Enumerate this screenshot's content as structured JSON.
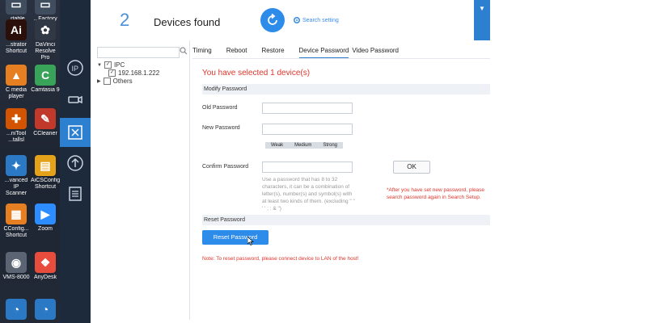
{
  "desktop": {
    "icons": [
      {
        "label": "..rtable",
        "color": "#3f4d5e",
        "glyph": "▭"
      },
      {
        "label": "...Factory\n...",
        "color": "#3f4d5e",
        "glyph": "▭"
      },
      {
        "label": "...strator\nShortcut",
        "color": "#2a0f0a",
        "glyph": "Ai"
      },
      {
        "label": "DaVinci\nResolve Pro",
        "color": "#303845",
        "glyph": "✿"
      },
      {
        "label": "C media\nplayer",
        "color": "#e67e22",
        "glyph": "▲"
      },
      {
        "label": "Camtasia 9",
        "color": "#3aa35a",
        "glyph": "C"
      },
      {
        "label": "...niTool\n...tallsl",
        "color": "#d35400",
        "glyph": "✚"
      },
      {
        "label": "CCleaner",
        "color": "#c0392b",
        "glyph": "✎"
      },
      {
        "label": "...vanced IP\nScanner",
        "color": "#2b78c4",
        "glyph": "✦"
      },
      {
        "label": "AiCSConfig\nShortcut",
        "color": "#e3a21a",
        "glyph": "▤"
      },
      {
        "label": "CConfig...\nShortcut",
        "color": "#e67e22",
        "glyph": "▦"
      },
      {
        "label": "Zoom",
        "color": "#2d8cff",
        "glyph": "▶"
      },
      {
        "label": "VMS-8000",
        "color": "#5a6472",
        "glyph": "◉"
      },
      {
        "label": "AnyDesk",
        "color": "#e74c3c",
        "glyph": "❖"
      },
      {
        "label": "",
        "color": "#2b78c4",
        "glyph": "◔"
      },
      {
        "label": "",
        "color": "#2b78c4",
        "glyph": "◔"
      }
    ]
  },
  "header": {
    "count": "2",
    "title": "Devices found",
    "search_setting": "Search setting"
  },
  "tree": {
    "root_label": "IPC",
    "device_ip": "192.168.1.222",
    "others_label": "Others"
  },
  "tabs": [
    "Timing",
    "Reboot",
    "Restore",
    "Device Password",
    "Video Password"
  ],
  "form": {
    "selected_msg": "You have selected 1 device(s)",
    "modify_heading": "Modify Password",
    "old_label": "Old Password",
    "new_label": "New Password",
    "confirm_label": "Confirm Password",
    "strength": [
      "Weak",
      "Medium",
      "Strong"
    ],
    "ok_label": "OK",
    "hint": "Use a password that has 8 to 32 characters, it can be a combination of letter(s), number(s) and symbol(s) with at least two kinds of them. (excluding \" \" ' ' ; : & \")",
    "note_right": "*After you have set new password, please search password again in Search Setup.",
    "reset_heading": "Reset Password",
    "reset_button": "Reset Password",
    "lan_note": "Note: To reset password, please connect device to LAN of the host!"
  },
  "colors": {
    "accent": "#2d8bea",
    "error": "#e0352b",
    "sidebar": "#1d2a3b"
  }
}
